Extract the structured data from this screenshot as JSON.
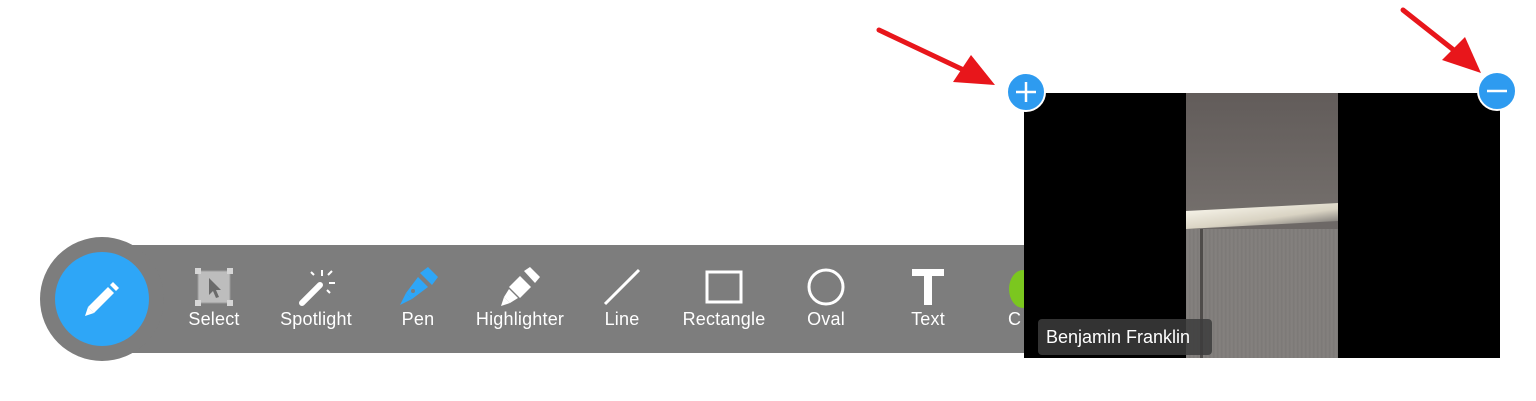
{
  "toolbar": {
    "tools": [
      {
        "label": "Select",
        "icon": "select-icon"
      },
      {
        "label": "Spotlight",
        "icon": "spotlight-icon"
      },
      {
        "label": "Pen",
        "icon": "pen-icon"
      },
      {
        "label": "Highlighter",
        "icon": "highlighter-icon"
      },
      {
        "label": "Line",
        "icon": "line-icon"
      },
      {
        "label": "Rectangle",
        "icon": "rectangle-icon"
      },
      {
        "label": "Oval",
        "icon": "oval-icon"
      },
      {
        "label": "Text",
        "icon": "text-icon"
      }
    ],
    "partial_label": "C",
    "main_icon": "pencil-icon"
  },
  "video": {
    "participant_name": "Benjamin Franklin",
    "enlarge_icon": "plus-icon",
    "shrink_icon": "minus-icon"
  },
  "colors": {
    "accent": "#2ea6f7",
    "toolbar_bg": "#7d7d7d",
    "arrow": "#e8161b",
    "active_tool": "#2ea6f7",
    "partial_color_swatch": "#7bc71f"
  }
}
